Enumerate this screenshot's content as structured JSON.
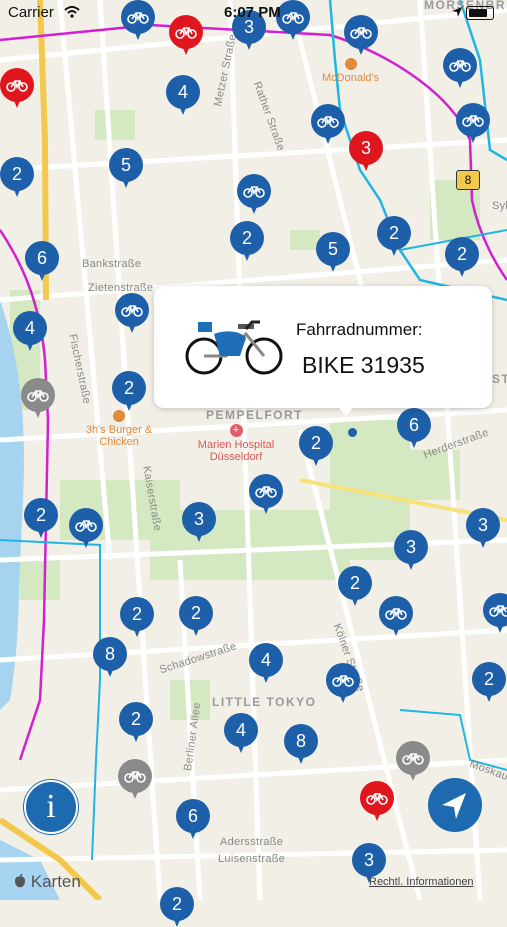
{
  "status_bar": {
    "carrier": "Carrier",
    "time": "6:07 PM"
  },
  "map": {
    "street_labels": [
      "Metzer Straße",
      "Rather Straße",
      "Bankstraße",
      "Zietenstraße",
      "Fischerstraße",
      "Kaiserstraße",
      "Schadowstraße",
      "Kölner Straße",
      "Berliner Allee",
      "Adersstraße",
      "Luisenstraße",
      "Herderstraße",
      "Moskauer",
      "Syb"
    ],
    "district_labels": [
      "PEMPELFORT",
      "LITTLE TOKYO",
      "MÖRSENBR",
      "STA"
    ],
    "poi_labels": {
      "mcdonalds": "McDonald's",
      "burger": "3h's Burger & Chicken",
      "hospital": "Marien Hospital Düsseldorf",
      "highway_shield": "8"
    },
    "pins": [
      {
        "kind": "blue",
        "text": "bike"
      },
      {
        "kind": "red",
        "text": "bike"
      },
      {
        "kind": "blue",
        "text": "3"
      },
      {
        "kind": "blue",
        "text": "bike"
      },
      {
        "kind": "blue",
        "text": "bike"
      },
      {
        "kind": "red",
        "text": "bike"
      },
      {
        "kind": "blue",
        "text": "4"
      },
      {
        "kind": "blue",
        "text": "bike"
      },
      {
        "kind": "blue",
        "text": "bike"
      },
      {
        "kind": "blue",
        "text": "bike"
      },
      {
        "kind": "red",
        "text": "3"
      },
      {
        "kind": "blue",
        "text": "2"
      },
      {
        "kind": "blue",
        "text": "5"
      },
      {
        "kind": "blue",
        "text": "bike"
      },
      {
        "kind": "blue",
        "text": "2"
      },
      {
        "kind": "blue",
        "text": "5"
      },
      {
        "kind": "blue",
        "text": "2"
      },
      {
        "kind": "blue",
        "text": "2"
      },
      {
        "kind": "blue",
        "text": "6"
      },
      {
        "kind": "blue",
        "text": "4"
      },
      {
        "kind": "blue",
        "text": "bike"
      },
      {
        "kind": "gray",
        "text": "bike"
      },
      {
        "kind": "blue",
        "text": "2"
      },
      {
        "kind": "blue",
        "text": "2"
      },
      {
        "kind": "blue",
        "text": "6"
      },
      {
        "kind": "blue",
        "text": "bike"
      },
      {
        "kind": "blue",
        "text": "2"
      },
      {
        "kind": "blue",
        "text": "bike"
      },
      {
        "kind": "blue",
        "text": "3"
      },
      {
        "kind": "blue",
        "text": "3"
      },
      {
        "kind": "blue",
        "text": "3"
      },
      {
        "kind": "blue",
        "text": "2"
      },
      {
        "kind": "blue",
        "text": "2"
      },
      {
        "kind": "blue",
        "text": "2"
      },
      {
        "kind": "blue",
        "text": "bike"
      },
      {
        "kind": "blue",
        "text": "bike"
      },
      {
        "kind": "blue",
        "text": "8"
      },
      {
        "kind": "blue",
        "text": "4"
      },
      {
        "kind": "blue",
        "text": "bike"
      },
      {
        "kind": "blue",
        "text": "2"
      },
      {
        "kind": "blue",
        "text": "2"
      },
      {
        "kind": "blue",
        "text": "4"
      },
      {
        "kind": "blue",
        "text": "8"
      },
      {
        "kind": "gray",
        "text": "bike"
      },
      {
        "kind": "gray",
        "text": "bike"
      },
      {
        "kind": "red",
        "text": "bike"
      },
      {
        "kind": "blue",
        "text": "6"
      },
      {
        "kind": "blue",
        "text": "3"
      },
      {
        "kind": "blue",
        "text": "2"
      }
    ]
  },
  "callout": {
    "title": "Fahrradnummer:",
    "value": "BIKE 31935"
  },
  "info_button": {
    "label": "i"
  },
  "footer": {
    "brand": "Karten",
    "legal": "Rechtl. Informationen"
  },
  "colors": {
    "pin_blue": "#1d5fa8",
    "pin_red": "#e0161f",
    "pin_gray": "#8a8a8a",
    "button_blue": "#1d6ab0",
    "route_cyan": "#1fb6e6",
    "route_magenta": "#d21fd2"
  }
}
